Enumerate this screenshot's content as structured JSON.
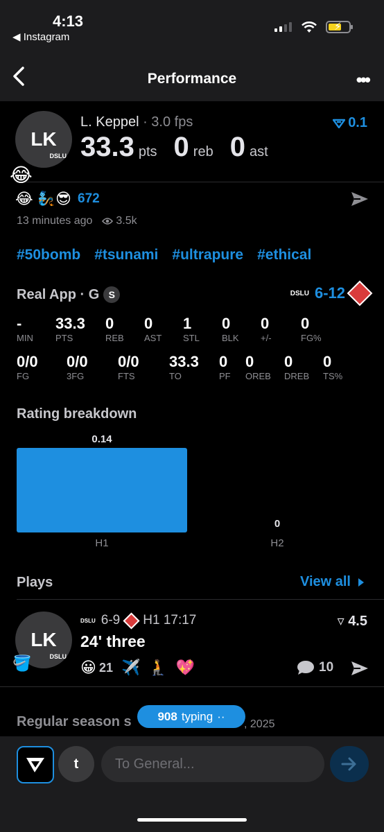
{
  "status": {
    "time": "4:13",
    "back_app": "◀ Instagram"
  },
  "nav": {
    "title": "Performance"
  },
  "header": {
    "avatar_initials": "LK",
    "avatar_team": "DSLU",
    "player": "L. Keppel",
    "fps": "· 3.0 fps",
    "rating": "0.1",
    "pts": "33.3",
    "pts_label": "pts",
    "reb": "0",
    "reb_label": "reb",
    "ast": "0",
    "ast_label": "ast"
  },
  "social": {
    "reaction_count": "672",
    "posted": "13 minutes ago",
    "views": "3.5k"
  },
  "tags": [
    "#50bomb",
    "#tsunami",
    "#ultrapure",
    "#ethical"
  ],
  "game": {
    "title": "Real App · G",
    "badge": "S",
    "team_abbr": "DSLU",
    "score": "6-12",
    "row1": [
      {
        "v": "-",
        "l": "MIN"
      },
      {
        "v": "33.3",
        "l": "PTS"
      },
      {
        "v": "0",
        "l": "REB"
      },
      {
        "v": "0",
        "l": "AST"
      },
      {
        "v": "1",
        "l": "STL"
      },
      {
        "v": "0",
        "l": "BLK"
      },
      {
        "v": "0",
        "l": "+/-"
      },
      {
        "v": "0",
        "l": "FG%"
      }
    ],
    "row2": [
      {
        "v": "0/0",
        "l": "FG"
      },
      {
        "v": "0/0",
        "l": "3FG"
      },
      {
        "v": "0/0",
        "l": "FTS"
      },
      {
        "v": "33.3",
        "l": "TO"
      },
      {
        "v": "0",
        "l": "PF"
      },
      {
        "v": "0",
        "l": "OREB"
      },
      {
        "v": "0",
        "l": "DREB"
      },
      {
        "v": "0",
        "l": "TS%"
      }
    ]
  },
  "breakdown": {
    "title": "Rating breakdown"
  },
  "chart_data": {
    "type": "bar",
    "title": "Rating breakdown",
    "categories": [
      "H1",
      "H2"
    ],
    "values": [
      0.14,
      0
    ],
    "value_labels": [
      "0.14",
      "0"
    ],
    "color": "#1e8fe0"
  },
  "plays": {
    "title": "Plays",
    "view_all": "View all",
    "item": {
      "avatar_initials": "LK",
      "avatar_team": "DSLU",
      "team_abbr": "DSLU",
      "score": "6-9",
      "time": "H1 17:17",
      "rating": "4.5",
      "title": "24' three",
      "reactions": "21",
      "comments": "10"
    }
  },
  "season": {
    "title": "Regular season s",
    "year": ", 2025"
  },
  "typing": {
    "count": "908",
    "label": "typing",
    "dots": "··"
  },
  "compose": {
    "t_label": "t",
    "placeholder": "To General..."
  },
  "colors": {
    "accent": "#1e8fe0",
    "background": "#000000",
    "bar": "#1c1c1e"
  }
}
